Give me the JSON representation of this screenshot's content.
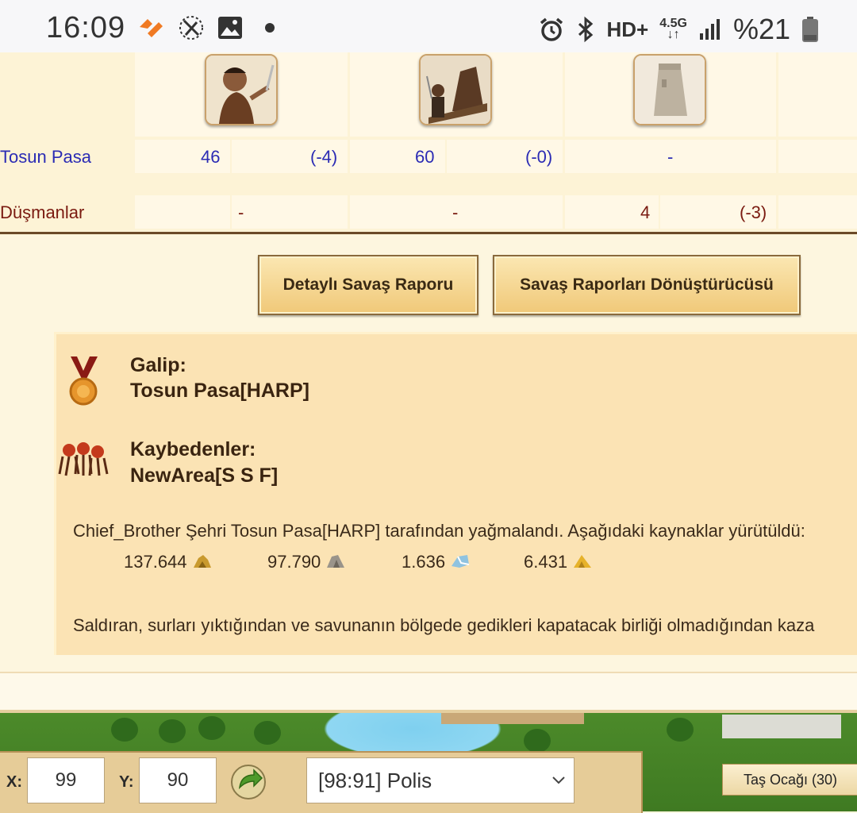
{
  "status_bar": {
    "time": "16:09",
    "network": "HD+",
    "network_gen": "4.5G",
    "battery": "%21"
  },
  "icons": {
    "app": "heart-app-icon",
    "tools": "tools-icon",
    "gallery": "image-icon",
    "dot": "notification-dot",
    "alarm": "alarm-icon",
    "bluetooth": "bluetooth-icon",
    "signal": "signal-icon",
    "battery": "battery-icon"
  },
  "units": [
    {
      "name": "slinger-icon"
    },
    {
      "name": "catapult-icon"
    },
    {
      "name": "tower-icon"
    }
  ],
  "table": {
    "rows": [
      {
        "label": "Tosun Pasa",
        "cells": [
          "46",
          "(-4)",
          "60",
          "(-0)",
          "-"
        ]
      },
      {
        "label": "Düşmanlar",
        "cells": [
          "-",
          "-",
          "4",
          "(-3)"
        ]
      }
    ]
  },
  "buttons": {
    "detailed_report": "Detaylı Savaş Raporu",
    "report_converter": "Savaş Raporları Dönüştürücüsü"
  },
  "report": {
    "winner_label": "Galip:",
    "winner_name": "Tosun Pasa[HARP]",
    "losers_label": "Kaybedenler:",
    "losers_name": "NewArea[S S F]",
    "plunder_text": "Chief_Brother Şehri Tosun Pasa[HARP] tarafından yağmalandı. Aşağıdaki kaynaklar yürütüldü:",
    "resources": [
      "137.644",
      "97.790",
      "1.636",
      "6.431"
    ],
    "wall_text": "Saldıran, surları yıktığından ve savunanın bölgede gedikleri kapatacak birliği olmadığından kaza"
  },
  "toolbar": {
    "x_label": "X:",
    "x_value": "99",
    "y_label": "Y:",
    "y_value": "90",
    "city_select": "[98:91] Polis",
    "tag": "Taş Ocağı (30)"
  }
}
